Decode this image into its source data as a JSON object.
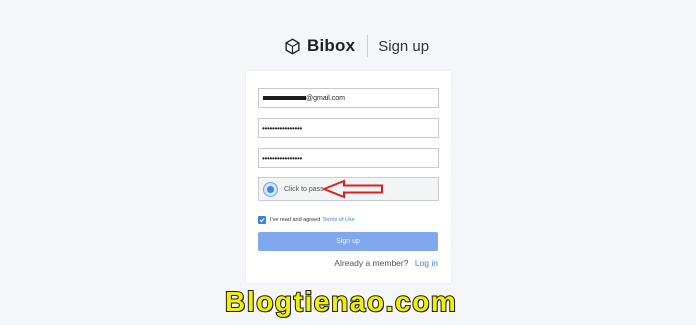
{
  "header": {
    "brand": "Bibox",
    "title": "Sign up",
    "logo_icon": "cube-logo-icon"
  },
  "form": {
    "email_value": "@gmail.com",
    "password_value": "••••••••••••••••",
    "confirm_password_value": "••••••••••••••••",
    "captcha_label": "Click to pass",
    "captcha_icon": "captcha-radar-icon",
    "agree_text": "I've read and agreed",
    "terms_link": "Terms of Use",
    "agree_checked": true,
    "submit_label": "Sign up",
    "member_text": "Already a member?",
    "login_link": "Log in"
  },
  "annotation": {
    "arrow_icon": "red-arrow-icon",
    "arrow_color": "#e0201f"
  },
  "watermark": "Blogtienao.com",
  "colors": {
    "accent": "#3c83e0",
    "button_disabled": "#7fa8ee",
    "background": "#f4f6f9",
    "watermark": "#f2ef00"
  }
}
